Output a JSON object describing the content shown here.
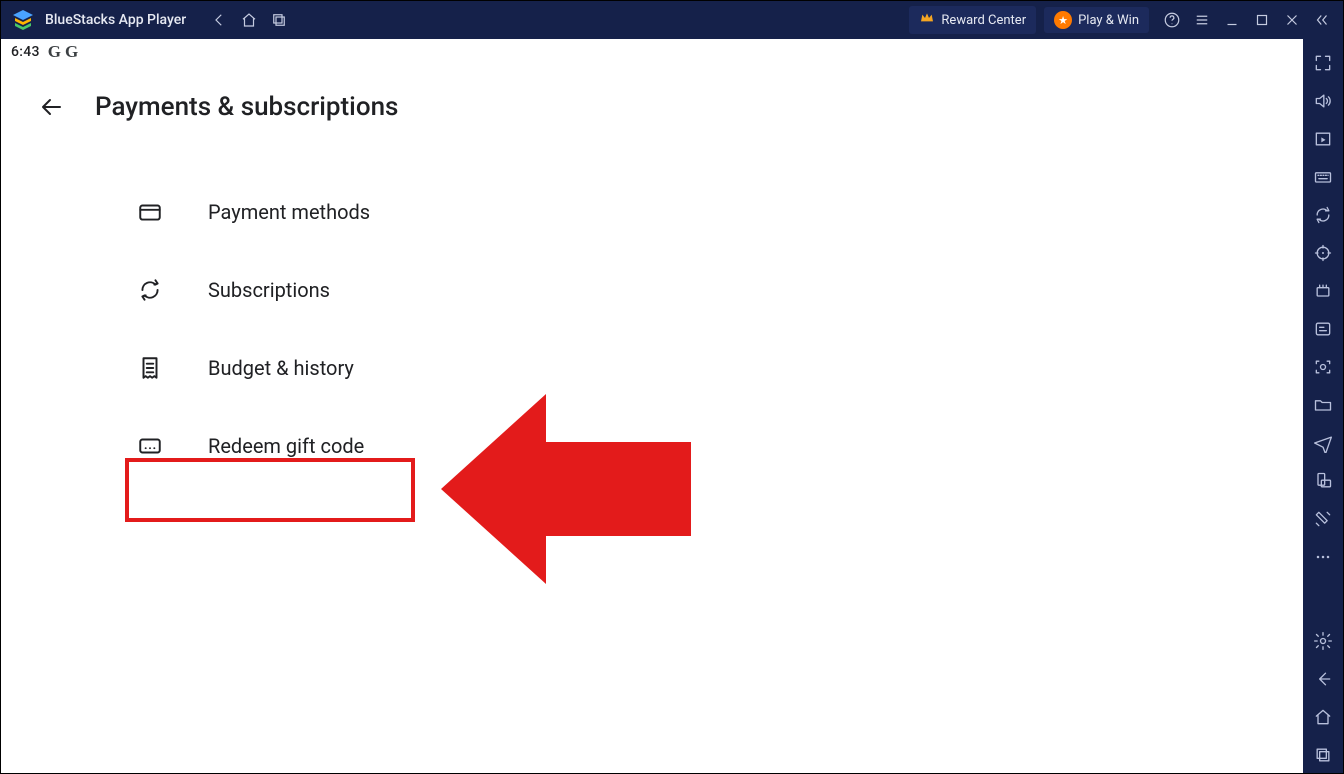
{
  "window": {
    "title": "BlueStacks App Player",
    "reward_center": "Reward Center",
    "play_win": "Play & Win"
  },
  "status": {
    "time": "6:43"
  },
  "page": {
    "title": "Payments & subscriptions",
    "items": [
      {
        "icon": "card-icon",
        "label": "Payment methods"
      },
      {
        "icon": "sync-icon",
        "label": "Subscriptions"
      },
      {
        "icon": "receipt-icon",
        "label": "Budget & history"
      },
      {
        "icon": "giftcode-icon",
        "label": "Redeem gift code"
      }
    ]
  }
}
